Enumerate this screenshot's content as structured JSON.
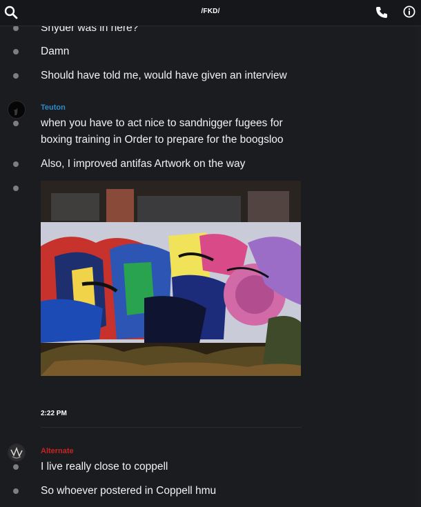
{
  "header": {
    "title": "/FKD/",
    "icons": [
      "search-icon",
      "phone-icon",
      "info-icon"
    ]
  },
  "messages": [
    {
      "text": "Snyder was in here?"
    },
    {
      "text": "Damn"
    },
    {
      "text": "Should have told me, would have given an interview"
    }
  ],
  "group_teuton": {
    "author": "Teuton",
    "author_color": "#2e8bc9",
    "lines": [
      "when you have to act nice to sandnigger fugees for",
      "boxing  training in Order to prepare for the boogsloo"
    ],
    "message2": "Also, I improved antifas Artwork on the way",
    "image_icon": "graffiti-photo",
    "time": "2:22 PM"
  },
  "group_alternate": {
    "author": "Alternate",
    "author_color": "#c8241f",
    "message1": "I live really close to coppell",
    "message2": "So whoever postered in Coppell hmu"
  }
}
